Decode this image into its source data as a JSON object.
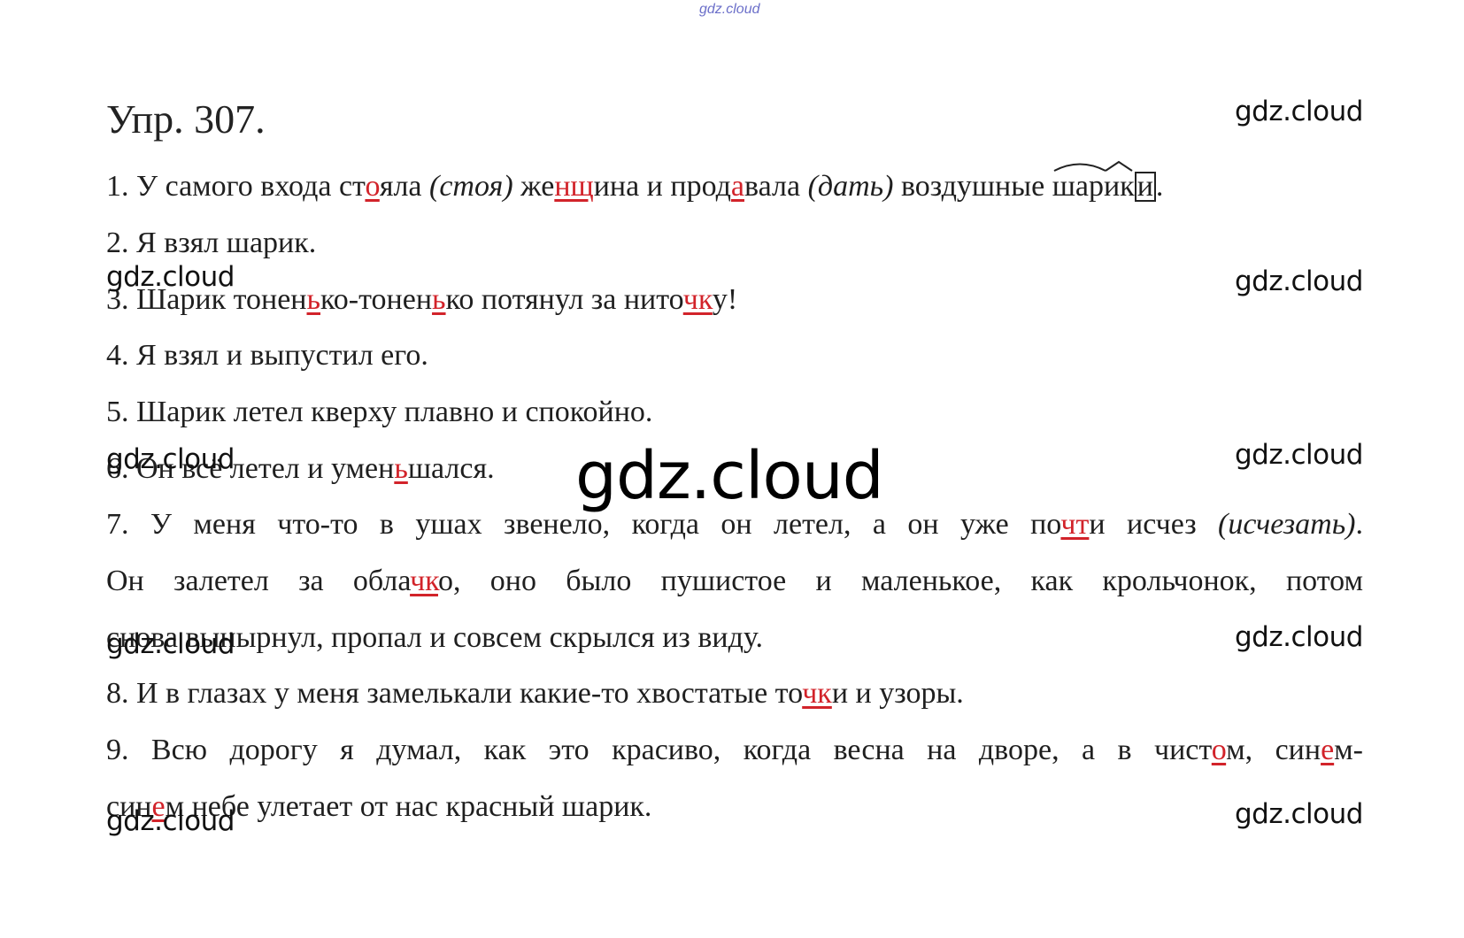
{
  "top_mark": "gdz.cloud",
  "watermark": "gdz.cloud",
  "heading": "Упр. 307.",
  "lines": {
    "l1": {
      "a": "1. У самого входа ст",
      "b": "о",
      "c": "яла ",
      "d": "(стоя)",
      "e": " же",
      "f": "нщ",
      "g": "ина и прод",
      "h": "а",
      "i": "вала ",
      "j": "(дать)",
      "k": " воздушные ",
      "l": "шар",
      "m": "ик",
      "n": "и",
      "o": "."
    },
    "l2": "2. Я взял шарик.",
    "l3": {
      "a": "3. Шарик тонен",
      "b": "ь",
      "c": "ко-тонен",
      "d": "ь",
      "e": "ко потянул за нито",
      "f": "чк",
      "g": "у!"
    },
    "l4": "4. Я взял и выпустил его.",
    "l5": "5. Шарик летел кверху плавно и спокойно.",
    "l6": {
      "a": "6. Он всё летел и умен",
      "b": "ь",
      "c": "шался."
    },
    "l7": {
      "a": "7. У меня что-то в ушах звенело, когда он летел, а он уже по",
      "b": "чт",
      "c": "и исчез ",
      "d": "(исчезать)",
      "e": "."
    },
    "l7b": {
      "a": "Он залетел за обла",
      "b": "чк",
      "c": "о, оно было пушистое и маленькое, как крольчонок, потом"
    },
    "l7c": "снова вынырнул, пропал и совсем скрылся из виду.",
    "l8": {
      "a": "8. И в глазах у меня замелькали какие-то хвостатые то",
      "b": "чк",
      "c": "и и узоры."
    },
    "l9": {
      "a": "9. Всю дорогу я думал, как это красиво, когда весна на дворе, а в чист",
      "b": "о",
      "c": "м, син",
      "d": "е",
      "e": "м-"
    },
    "l9b": {
      "a": "син",
      "b": "е",
      "c": "м небе улетает от нас красный шарик."
    }
  }
}
